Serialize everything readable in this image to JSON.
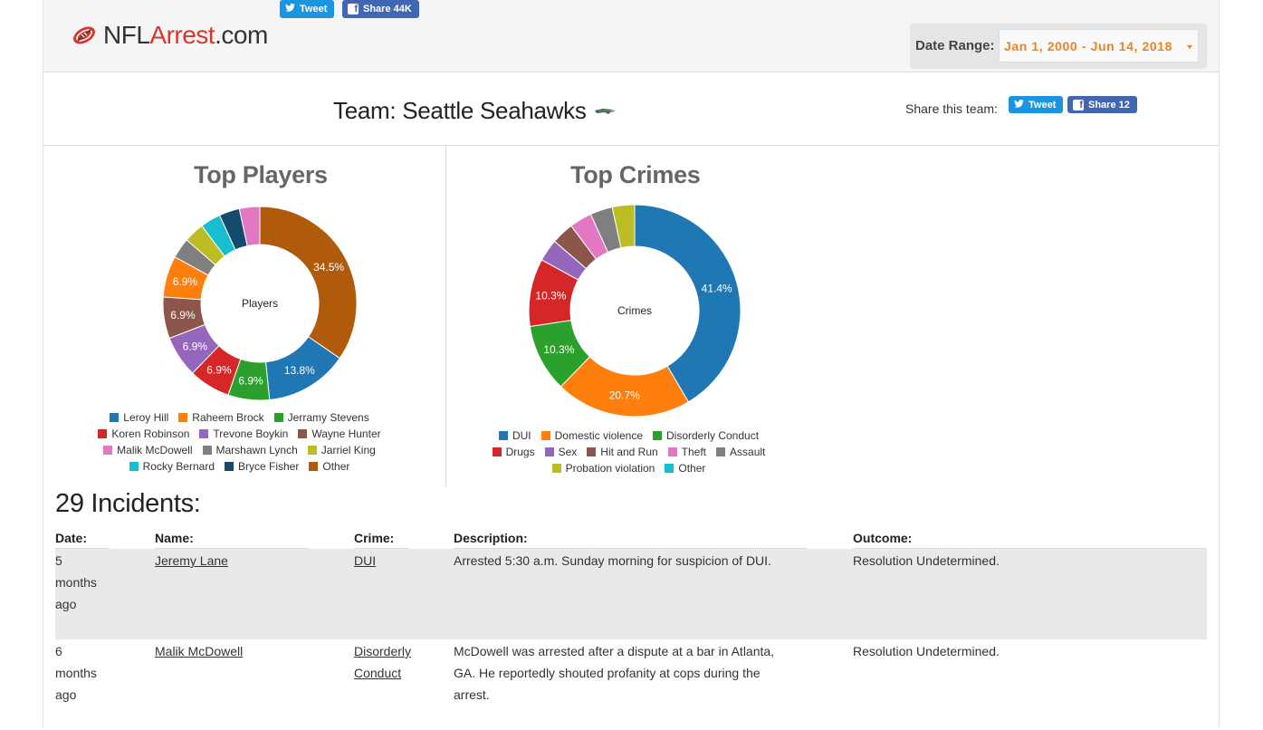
{
  "header": {
    "logo": {
      "part1": "NFL",
      "part2": "Arrest",
      "part3": ".com"
    },
    "tweet_label": "Tweet",
    "share_label": "Share 44K",
    "date_range_label": "Date Range:",
    "date_range_value": "Jan 1, 2000 - Jun 14, 2018"
  },
  "team": {
    "title": "Team: Seattle Seahawks",
    "share_label": "Share this team:",
    "tweet_label": "Tweet",
    "share_count_label": "Share 12"
  },
  "colors": {
    "blue": "#1f77b4",
    "orange": "#ff7f0e",
    "green": "#2ca02c",
    "red": "#d62728",
    "purple": "#9467bd",
    "brown": "#8c564b",
    "pink": "#e377c2",
    "gray": "#7f7f7f",
    "olive": "#bcbd22",
    "cyan": "#17becf",
    "navy": "#134b6d",
    "other_brown": "#b05a0c"
  },
  "chart_data": [
    {
      "type": "pie",
      "title": "Top Players",
      "center_label": "Players",
      "legend_placement": "bottom",
      "slices": [
        {
          "name": "Leroy Hill",
          "value": 13.8,
          "label": "13.8%",
          "color": "#1f77b4"
        },
        {
          "name": "Raheem Brock",
          "value": 6.9,
          "label": "6.9%",
          "color": "#ff7f0e"
        },
        {
          "name": "Jerramy Stevens",
          "value": 6.9,
          "label": "6.9%",
          "color": "#2ca02c"
        },
        {
          "name": "Koren Robinson",
          "value": 6.9,
          "label": "6.9%",
          "color": "#d62728"
        },
        {
          "name": "Trevone Boykin",
          "value": 6.9,
          "label": "6.9%",
          "color": "#9467bd"
        },
        {
          "name": "Wayne Hunter",
          "value": 6.9,
          "label": "6.9%",
          "color": "#8c564b"
        },
        {
          "name": "Malik McDowell",
          "value": 3.4,
          "label": "",
          "color": "#e377c2"
        },
        {
          "name": "Marshawn Lynch",
          "value": 3.4,
          "label": "",
          "color": "#7f7f7f"
        },
        {
          "name": "Jarriel King",
          "value": 3.4,
          "label": "",
          "color": "#bcbd22"
        },
        {
          "name": "Rocky Bernard",
          "value": 3.4,
          "label": "",
          "color": "#17becf"
        },
        {
          "name": "Bryce Fisher",
          "value": 3.4,
          "label": "",
          "color": "#134b6d"
        },
        {
          "name": "Other",
          "value": 34.5,
          "label": "34.5%",
          "color": "#b05a0c"
        }
      ],
      "draw_order": [
        "Other",
        "Leroy Hill",
        "Jerramy Stevens",
        "Koren Robinson",
        "Trevone Boykin",
        "Wayne Hunter",
        "Raheem Brock",
        "Marshawn Lynch",
        "Jarriel King",
        "Rocky Bernard",
        "Bryce Fisher",
        "Malik McDowell"
      ],
      "legend_rows": [
        [
          "Leroy Hill",
          "Raheem Brock",
          "Jerramy Stevens"
        ],
        [
          "Koren Robinson",
          "Trevone Boykin",
          "Wayne Hunter"
        ],
        [
          "Malik McDowell",
          "Marshawn Lynch",
          "Jarriel King"
        ],
        [
          "Rocky Bernard",
          "Bryce Fisher",
          "Other"
        ]
      ]
    },
    {
      "type": "pie",
      "title": "Top Crimes",
      "center_label": "Crimes",
      "legend_placement": "bottom",
      "slices": [
        {
          "name": "DUI",
          "value": 41.4,
          "label": "41.4%",
          "color": "#1f77b4"
        },
        {
          "name": "Domestic violence",
          "value": 20.7,
          "label": "20.7%",
          "color": "#ff7f0e"
        },
        {
          "name": "Disorderly Conduct",
          "value": 10.3,
          "label": "10.3%",
          "color": "#2ca02c"
        },
        {
          "name": "Drugs",
          "value": 10.3,
          "label": "10.3%",
          "color": "#d62728"
        },
        {
          "name": "Sex",
          "value": 3.4,
          "label": "",
          "color": "#9467bd"
        },
        {
          "name": "Hit and Run",
          "value": 3.4,
          "label": "",
          "color": "#8c564b"
        },
        {
          "name": "Theft",
          "value": 3.4,
          "label": "",
          "color": "#e377c2"
        },
        {
          "name": "Assault",
          "value": 3.4,
          "label": "",
          "color": "#7f7f7f"
        },
        {
          "name": "Probation violation",
          "value": 3.4,
          "label": "",
          "color": "#bcbd22"
        },
        {
          "name": "Other",
          "value": 0,
          "label": "",
          "color": "#17becf"
        }
      ],
      "draw_order": [
        "DUI",
        "Domestic violence",
        "Disorderly Conduct",
        "Drugs",
        "Sex",
        "Hit and Run",
        "Theft",
        "Assault",
        "Probation violation"
      ],
      "legend_rows": [
        [
          "DUI",
          "Domestic violence",
          "Disorderly Conduct"
        ],
        [
          "Drugs",
          "Sex",
          "Hit and Run",
          "Theft",
          "Assault"
        ],
        [
          "Probation violation",
          "Other"
        ]
      ]
    }
  ],
  "incidents": {
    "heading": "29 Incidents:",
    "columns": [
      "Date:",
      "Name:",
      "Crime:",
      "Description:",
      "Outcome:"
    ],
    "rows": [
      {
        "date_lines": [
          "5",
          "months",
          "ago"
        ],
        "name": "Jeremy Lane",
        "crime_lines": [
          "DUI"
        ],
        "description_lines": [
          "Arrested 5:30 a.m. Sunday morning for suspicion of DUI."
        ],
        "outcome": "Resolution Undetermined."
      },
      {
        "date_lines": [
          "6",
          "months",
          "ago"
        ],
        "name": "Malik McDowell",
        "crime_lines": [
          "Disorderly",
          "Conduct"
        ],
        "description_lines": [
          "McDowell was arrested after a dispute at a bar in Atlanta,",
          "GA. He reportedly shouted profanity at cops during the",
          "arrest."
        ],
        "outcome": "Resolution Undetermined."
      }
    ]
  }
}
